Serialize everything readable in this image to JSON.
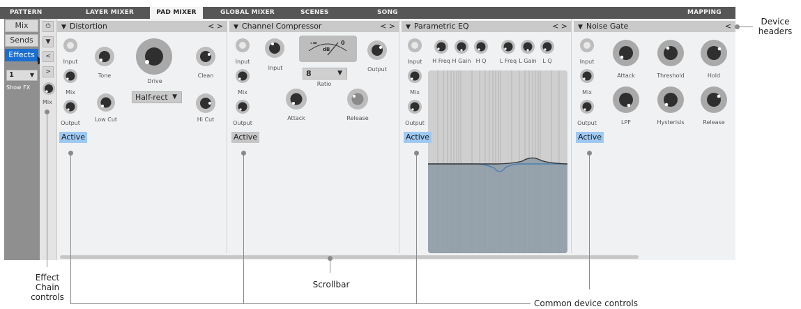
{
  "top_tabs": [
    {
      "label": "PATTERN",
      "active": false
    },
    {
      "label": "LAYER MIXER",
      "active": false
    },
    {
      "label": "PAD MIXER",
      "active": true
    },
    {
      "label": "GLOBAL MIXER",
      "active": false
    },
    {
      "label": "SCENES",
      "active": false
    },
    {
      "label": "SONG",
      "active": false
    },
    {
      "label": "MAPPING",
      "active": false
    }
  ],
  "left": {
    "buttons": [
      "Mix",
      "Sends",
      "Effects"
    ],
    "active_button": "Effects",
    "fx_selector": "1",
    "show_fx": "Show FX"
  },
  "chain": {
    "power_glyph": "⏻",
    "collapse_glyph": "▼",
    "left_glyph": "<",
    "right_glyph": ">",
    "mix_label": "Mix"
  },
  "devices": [
    {
      "name": "Distortion",
      "arrows": "< >",
      "controls": [
        "Input",
        "Mix",
        "Output",
        "Tone",
        "Low Cut",
        "Drive",
        "Clean",
        "Hi Cut"
      ],
      "mode_dropdown": "Half-rect",
      "active_label": "Active",
      "active_state": "on"
    },
    {
      "name": "Channel Compressor",
      "arrows": "< >",
      "controls": [
        "Input",
        "Mix",
        "Output",
        "Input",
        "Output",
        "Attack",
        "Release"
      ],
      "meter": {
        "minus_inf": "-∞",
        "unit": "dB",
        "zero": "0"
      },
      "ratio_value": "8",
      "ratio_label": "Ratio",
      "active_label": "Active",
      "active_state": "off"
    },
    {
      "name": "Parametric EQ",
      "arrows": "< >",
      "controls": [
        "Input",
        "Mix",
        "Output",
        "H Freq",
        "H Gain",
        "H Q",
        "L Freq",
        "L Gain",
        "L Q"
      ],
      "active_label": "Active",
      "active_state": "on"
    },
    {
      "name": "Noise Gate",
      "arrows": "<",
      "controls": [
        "Input",
        "Mix",
        "Output",
        "Attack",
        "Threshold",
        "Hold",
        "LPF",
        "Hysterisis",
        "Release"
      ],
      "active_label": "Active",
      "active_state": "on"
    }
  ],
  "annotations": {
    "device_headers": "Device headers",
    "effect_chain_controls": "Effect Chain controls",
    "scrollbar": "Scrollbar",
    "common_device_controls": "Common device controls"
  },
  "colors": {
    "menu_bar": "#565656",
    "active_blue": "#1b6fd1",
    "active_button_on": "#9ec9f2",
    "knob_ring": "#bdbdbd",
    "knob_body": "#2f2f2f"
  }
}
